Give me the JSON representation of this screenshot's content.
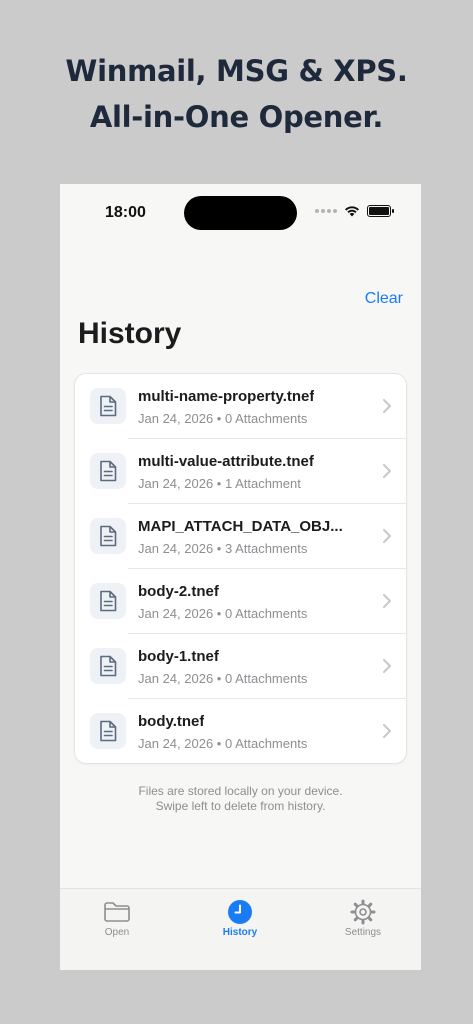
{
  "promo": {
    "line1": "Winmail, MSG & XPS.",
    "line2": "All-in-One Opener."
  },
  "status_bar": {
    "time": "18:00"
  },
  "header": {
    "clear_label": "Clear",
    "title": "History"
  },
  "history": {
    "items": [
      {
        "name": "multi-name-property.tnef",
        "meta": "Jan 24, 2026 • 0 Attachments"
      },
      {
        "name": "multi-value-attribute.tnef",
        "meta": "Jan 24, 2026 • 1 Attachment"
      },
      {
        "name": "MAPI_ATTACH_DATA_OBJ...",
        "meta": "Jan 24, 2026 • 3 Attachments"
      },
      {
        "name": "body-2.tnef",
        "meta": "Jan 24, 2026 • 0 Attachments"
      },
      {
        "name": "body-1.tnef",
        "meta": "Jan 24, 2026 • 0 Attachments"
      },
      {
        "name": "body.tnef",
        "meta": "Jan 24, 2026 • 0 Attachments"
      }
    ],
    "icon": "document-icon"
  },
  "footer": {
    "line1": "Files are stored locally on your device.",
    "line2": "Swipe left to delete from history."
  },
  "tabbar": {
    "tabs": [
      {
        "label": "Open",
        "icon": "folder-icon",
        "active": false
      },
      {
        "label": "History",
        "icon": "clock-icon",
        "active": true
      },
      {
        "label": "Settings",
        "icon": "gear-icon",
        "active": false
      }
    ]
  },
  "colors": {
    "accent": "#1a7cf5",
    "background": "#cbcbcb",
    "promo_text": "#1e2a3b"
  }
}
